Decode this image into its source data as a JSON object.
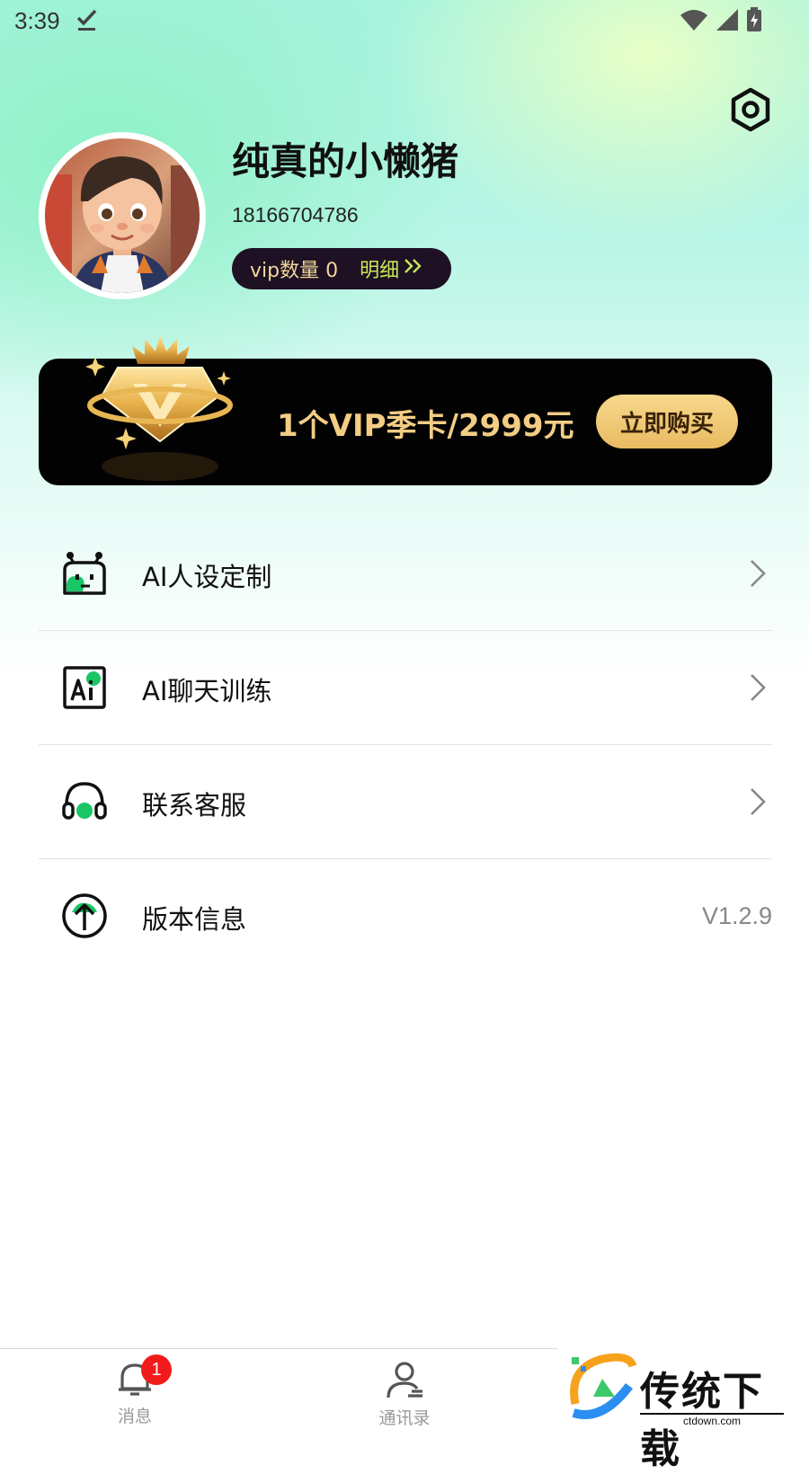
{
  "status_bar": {
    "time": "3:39"
  },
  "profile": {
    "nickname": "纯真的小懒猪",
    "phone": "18166704786",
    "vip_count_label": "vip数量 0",
    "detail_label": "明细"
  },
  "banner": {
    "offer_text": "1个VIP季卡/2999元",
    "buy_label": "立即购买"
  },
  "menu": {
    "items": [
      {
        "label": "AI人设定制"
      },
      {
        "label": "AI聊天训练"
      },
      {
        "label": "联系客服"
      },
      {
        "label": "版本信息",
        "value": "V1.2.9"
      }
    ]
  },
  "tabbar": {
    "tabs": [
      {
        "label": "消息",
        "badge": "1"
      },
      {
        "label": "通讯录"
      }
    ]
  },
  "watermark": {
    "text": "传统下载",
    "url": "ctdown.com"
  },
  "colors": {
    "accent_green": "#19c565",
    "vip_gold": "#f3cd84",
    "badge_red": "#f21b1b"
  }
}
